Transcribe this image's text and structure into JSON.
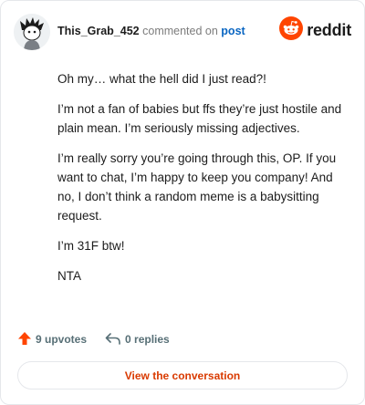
{
  "comment": {
    "username": "This_Grab_452",
    "action_text": "commented on",
    "post_link": "post",
    "brand": "reddit",
    "paragraphs": [
      "Oh my… what the hell did I just read?!",
      "I’m not a fan of babies but ffs they’re just hostile and plain mean. I’m seriously missing adjectives.",
      "I’m really sorry you’re going through this, OP. If you want to chat, I’m happy to keep you company! And no, I don’t think a random meme is a babysitting request.",
      "I’m 31F btw!",
      "NTA"
    ],
    "upvotes": "9 upvotes",
    "replies": "0 replies",
    "cta": "View the conversation"
  },
  "colors": {
    "reddit_orange": "#ff4500",
    "cta_text": "#d93a00",
    "link_blue": "#0a66c2",
    "muted": "#576f76"
  },
  "icons": [
    "avatar",
    "reddit-logo-icon",
    "upvote-arrow-icon",
    "reply-arrow-icon"
  ]
}
